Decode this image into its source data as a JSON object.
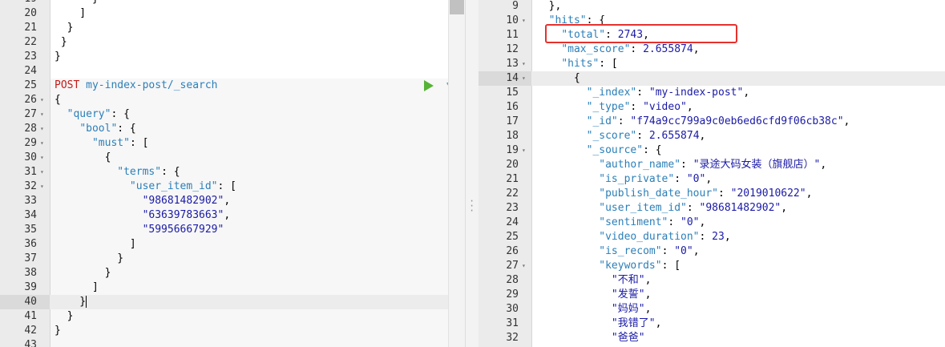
{
  "left_editor": {
    "lines": [
      {
        "n": "19",
        "t": "      }"
      },
      {
        "n": "20",
        "t": "    ]"
      },
      {
        "n": "21",
        "t": "  }"
      },
      {
        "n": "22",
        "t": " }"
      },
      {
        "n": "23",
        "t": "}"
      },
      {
        "n": "24",
        "t": ""
      },
      {
        "n": "25",
        "t": "POST my-index-post/_search"
      },
      {
        "n": "26",
        "t": "{"
      },
      {
        "n": "27",
        "t": "  \"query\": {"
      },
      {
        "n": "28",
        "t": "    \"bool\": {"
      },
      {
        "n": "29",
        "t": "      \"must\": ["
      },
      {
        "n": "30",
        "t": "        {"
      },
      {
        "n": "31",
        "t": "          \"terms\": {"
      },
      {
        "n": "32",
        "t": "            \"user_item_id\": ["
      },
      {
        "n": "33",
        "t": "              \"98681482902\","
      },
      {
        "n": "34",
        "t": "              \"63639783663\","
      },
      {
        "n": "35",
        "t": "              \"59956667929\""
      },
      {
        "n": "36",
        "t": "            ]"
      },
      {
        "n": "37",
        "t": "          }"
      },
      {
        "n": "38",
        "t": "        }"
      },
      {
        "n": "39",
        "t": "      ]"
      },
      {
        "n": "40",
        "t": "    }"
      },
      {
        "n": "41",
        "t": "  }"
      },
      {
        "n": "42",
        "t": "}"
      },
      {
        "n": "43",
        "t": ""
      }
    ],
    "request_method": "POST",
    "request_path": "my-index-post/_search",
    "run_icon": "play-icon",
    "settings_icon": "wrench-icon"
  },
  "right_editor": {
    "lines": [
      {
        "n": "9",
        "t": "  },"
      },
      {
        "n": "10",
        "t": "  \"hits\": {"
      },
      {
        "n": "11",
        "t": "    \"total\": 2743,"
      },
      {
        "n": "12",
        "t": "    \"max_score\": 2.655874,"
      },
      {
        "n": "13",
        "t": "    \"hits\": ["
      },
      {
        "n": "14",
        "t": "      {"
      },
      {
        "n": "15",
        "t": "        \"_index\": \"my-index-post\","
      },
      {
        "n": "16",
        "t": "        \"_type\": \"video\","
      },
      {
        "n": "17",
        "t": "        \"_id\": \"f74a9cc799a9c0eb6ed6cfd9f06cb38c\","
      },
      {
        "n": "18",
        "t": "        \"_score\": 2.655874,"
      },
      {
        "n": "19",
        "t": "        \"_source\": {"
      },
      {
        "n": "20",
        "t": "          \"author_name\": \"录途大码女装（旗舰店）\","
      },
      {
        "n": "21",
        "t": "          \"is_private\": \"0\","
      },
      {
        "n": "22",
        "t": "          \"publish_date_hour\": \"2019010622\","
      },
      {
        "n": "23",
        "t": "          \"user_item_id\": \"98681482902\","
      },
      {
        "n": "24",
        "t": "          \"sentiment\": \"0\","
      },
      {
        "n": "25",
        "t": "          \"video_duration\": 23,"
      },
      {
        "n": "26",
        "t": "          \"is_recom\": \"0\","
      },
      {
        "n": "27",
        "t": "          \"keywords\": ["
      },
      {
        "n": "28",
        "t": "            \"不和\","
      },
      {
        "n": "29",
        "t": "            \"发誓\","
      },
      {
        "n": "30",
        "t": "            \"妈妈\","
      },
      {
        "n": "31",
        "t": "            \"我错了\","
      },
      {
        "n": "32",
        "t": "            \"爸爸\""
      }
    ]
  },
  "colors": {
    "highlight_box": "#e5322d",
    "run_button": "#57b337",
    "method": "#c41a16",
    "key": "#2c7fb8",
    "value": "#1a1aa6"
  }
}
